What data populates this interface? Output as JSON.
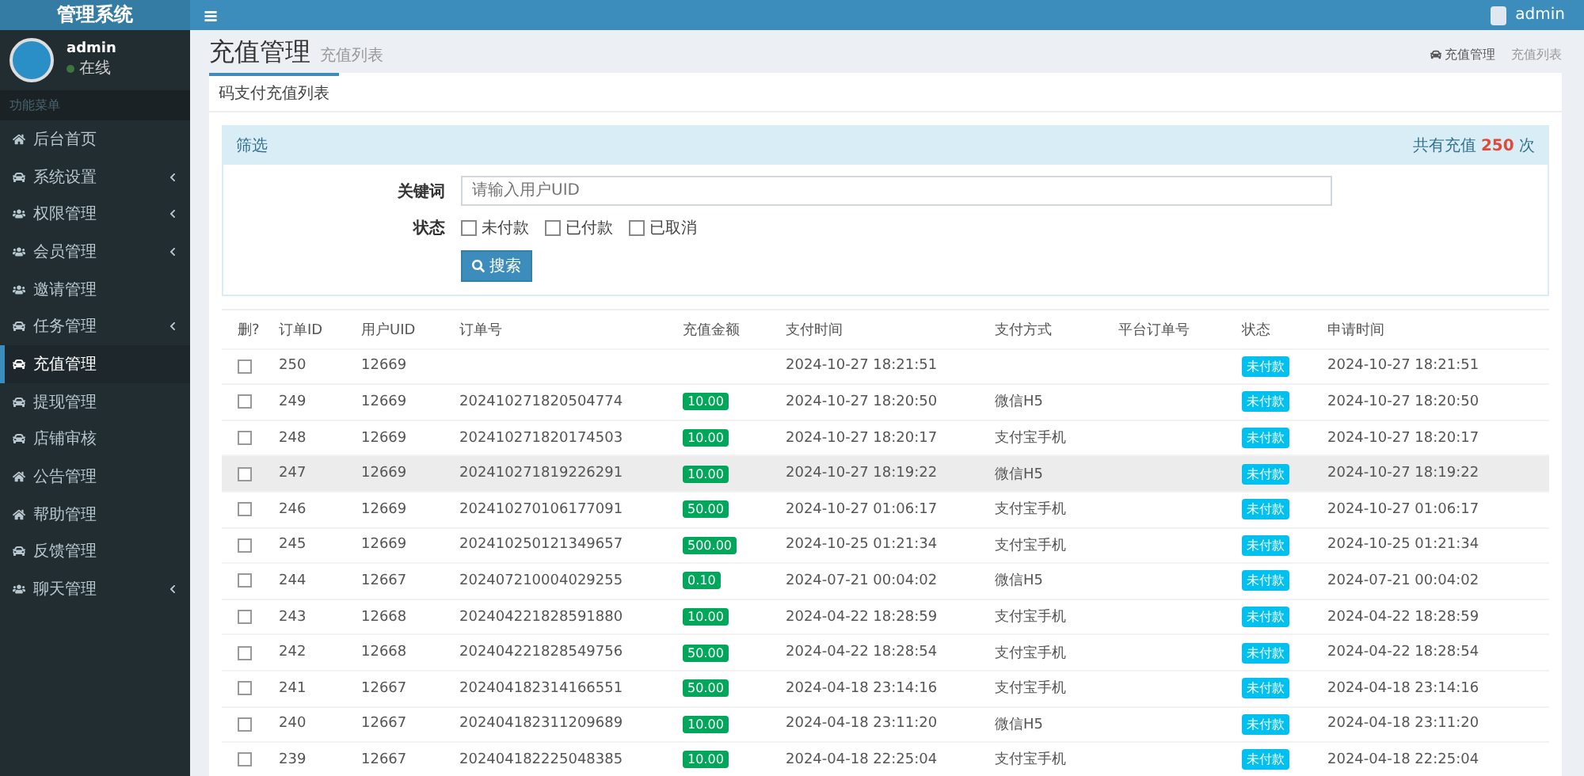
{
  "brand": "管理系统",
  "menu_toggle": "≡",
  "user": {
    "name": "admin",
    "status": "在线"
  },
  "top_user": "admin",
  "sidebar": {
    "section": "功能菜单",
    "items": [
      {
        "label": "后台首页",
        "expandable": false,
        "selected": false
      },
      {
        "label": "系统设置",
        "expandable": true,
        "selected": false
      },
      {
        "label": "权限管理",
        "expandable": true,
        "selected": false
      },
      {
        "label": "会员管理",
        "expandable": true,
        "selected": false
      },
      {
        "label": "邀请管理",
        "expandable": false,
        "selected": false
      },
      {
        "label": "任务管理",
        "expandable": true,
        "selected": false
      },
      {
        "label": "充值管理",
        "expandable": false,
        "selected": true
      },
      {
        "label": "提现管理",
        "expandable": false,
        "selected": false
      },
      {
        "label": "店铺审核",
        "expandable": false,
        "selected": false
      },
      {
        "label": "公告管理",
        "expandable": false,
        "selected": false
      },
      {
        "label": "帮助管理",
        "expandable": false,
        "selected": false
      },
      {
        "label": "反馈管理",
        "expandable": false,
        "selected": false
      },
      {
        "label": "聊天管理",
        "expandable": true,
        "selected": false
      }
    ]
  },
  "page": {
    "title": "充值管理",
    "subtitle": "充值列表",
    "breadcrumb": [
      "充值管理",
      "充值列表"
    ]
  },
  "tabs": [
    {
      "label": "码支付充值列表",
      "selected": true
    }
  ],
  "filter": {
    "title": "筛选",
    "count_prefix": "共有充值",
    "count": "250",
    "count_suffix": "次",
    "keyword_label": "关键词",
    "keyword_placeholder": "请输入用户UID",
    "status_label": "状态",
    "statuses": [
      {
        "label": "未付款",
        "checked": false
      },
      {
        "label": "已付款",
        "checked": false
      },
      {
        "label": "已取消",
        "checked": false
      }
    ],
    "search_button": "搜索"
  },
  "table": {
    "columns": [
      "删?",
      "订单ID",
      "用户UID",
      "订单号",
      "充值金额",
      "支付时间",
      "支付方式",
      "平台订单号",
      "状态",
      "申请时间"
    ],
    "rows": [
      {
        "id": "250",
        "uid": "12669",
        "pay_time": "2024-10-27 18:21:51",
        "status": "未付款",
        "apply_time": "2024-10-27 18:21:51",
        "checked": false,
        "highlighted": false
      },
      {
        "id": "249",
        "uid": "12669",
        "order_no": "202410271820504774",
        "amount": "10.00",
        "pay_time": "2024-10-27 18:20:50",
        "method": "微信H5",
        "status": "未付款",
        "apply_time": "2024-10-27 18:20:50",
        "checked": false,
        "highlighted": false
      },
      {
        "id": "248",
        "uid": "12669",
        "order_no": "202410271820174503",
        "amount": "10.00",
        "pay_time": "2024-10-27 18:20:17",
        "method": "支付宝手机",
        "status": "未付款",
        "apply_time": "2024-10-27 18:20:17",
        "checked": false,
        "highlighted": false
      },
      {
        "id": "247",
        "uid": "12669",
        "order_no": "202410271819226291",
        "amount": "10.00",
        "pay_time": "2024-10-27 18:19:22",
        "method": "微信H5",
        "status": "未付款",
        "apply_time": "2024-10-27 18:19:22",
        "checked": false,
        "highlighted": true
      },
      {
        "id": "246",
        "uid": "12669",
        "order_no": "202410270106177091",
        "amount": "50.00",
        "pay_time": "2024-10-27 01:06:17",
        "method": "支付宝手机",
        "status": "未付款",
        "apply_time": "2024-10-27 01:06:17",
        "checked": false,
        "highlighted": false
      },
      {
        "id": "245",
        "uid": "12669",
        "order_no": "202410250121349657",
        "amount": "500.00",
        "pay_time": "2024-10-25 01:21:34",
        "method": "支付宝手机",
        "status": "未付款",
        "apply_time": "2024-10-25 01:21:34",
        "checked": false,
        "highlighted": false
      },
      {
        "id": "244",
        "uid": "12667",
        "order_no": "202407210004029255",
        "amount": "0.10",
        "pay_time": "2024-07-21 00:04:02",
        "method": "微信H5",
        "status": "未付款",
        "apply_time": "2024-07-21 00:04:02",
        "checked": false,
        "highlighted": false
      },
      {
        "id": "243",
        "uid": "12668",
        "order_no": "202404221828591880",
        "amount": "10.00",
        "pay_time": "2024-04-22 18:28:59",
        "method": "支付宝手机",
        "status": "未付款",
        "apply_time": "2024-04-22 18:28:59",
        "checked": false,
        "highlighted": false
      },
      {
        "id": "242",
        "uid": "12668",
        "order_no": "202404221828549756",
        "amount": "50.00",
        "pay_time": "2024-04-22 18:28:54",
        "method": "支付宝手机",
        "status": "未付款",
        "apply_time": "2024-04-22 18:28:54",
        "checked": false,
        "highlighted": false
      },
      {
        "id": "241",
        "uid": "12667",
        "order_no": "202404182314166551",
        "amount": "50.00",
        "pay_time": "2024-04-18 23:14:16",
        "method": "支付宝手机",
        "status": "未付款",
        "apply_time": "2024-04-18 23:14:16",
        "checked": false,
        "highlighted": false
      },
      {
        "id": "240",
        "uid": "12667",
        "order_no": "202404182311209689",
        "amount": "10.00",
        "pay_time": "2024-04-18 23:11:20",
        "method": "微信H5",
        "status": "未付款",
        "apply_time": "2024-04-18 23:11:20",
        "checked": false,
        "highlighted": false
      },
      {
        "id": "239",
        "uid": "12667",
        "order_no": "202404182225048385",
        "amount": "10.00",
        "pay_time": "2024-04-18 22:25:04",
        "method": "支付宝手机",
        "status": "未付款",
        "apply_time": "2024-04-18 22:25:04",
        "checked": false,
        "highlighted": false
      }
    ]
  }
}
